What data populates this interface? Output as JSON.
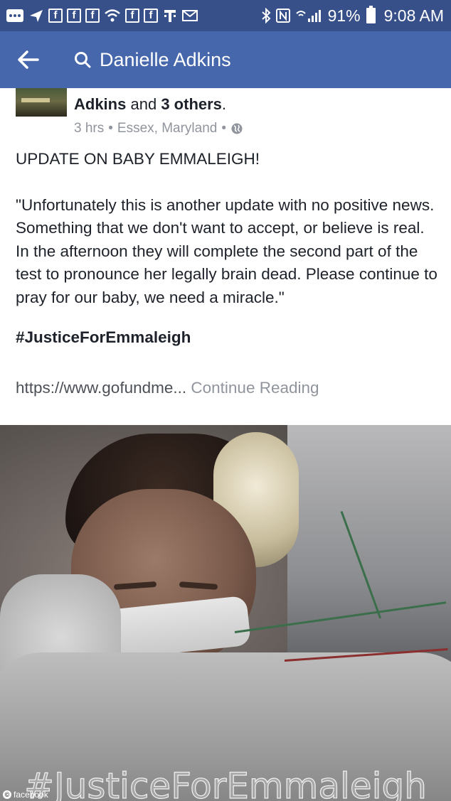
{
  "status_bar": {
    "battery_percent": "91%",
    "time": "9:08 AM",
    "icons": [
      "more-icon",
      "send-icon",
      "facebook-icon",
      "facebook-icon",
      "facebook-icon",
      "wifi-icon",
      "facebook-icon",
      "facebook-icon",
      "tmobile-icon",
      "mail-icon",
      "bluetooth-icon",
      "nfc-icon",
      "signal-icon",
      "battery-icon"
    ]
  },
  "header": {
    "search_text": "Danielle Adkins"
  },
  "post": {
    "author_name": "Adkins",
    "author_connector": "and",
    "others": "3 others",
    "period": ".",
    "time_ago": "3 hrs",
    "location": "Essex, Maryland",
    "separator": "•",
    "privacy_icon": "globe-icon",
    "headline": "UPDATE ON BABY EMMALEIGH!",
    "quote": "\"Unfortunately this is another update with no positive news. Something that we don't want to accept, or believe is real. In the afternoon they will complete the second part of the test to pronounce her legally brain dead. Please continue to pray for our baby, we need a miracle.\"",
    "hashtag": "#JusticeForEmmaleigh",
    "link_url": "https://www.gofundme...",
    "continue_label": "Continue Reading"
  },
  "photo": {
    "caption": "#JusticeForEmmaleigh",
    "watermark": "facebook",
    "watermark_mark": "©"
  }
}
